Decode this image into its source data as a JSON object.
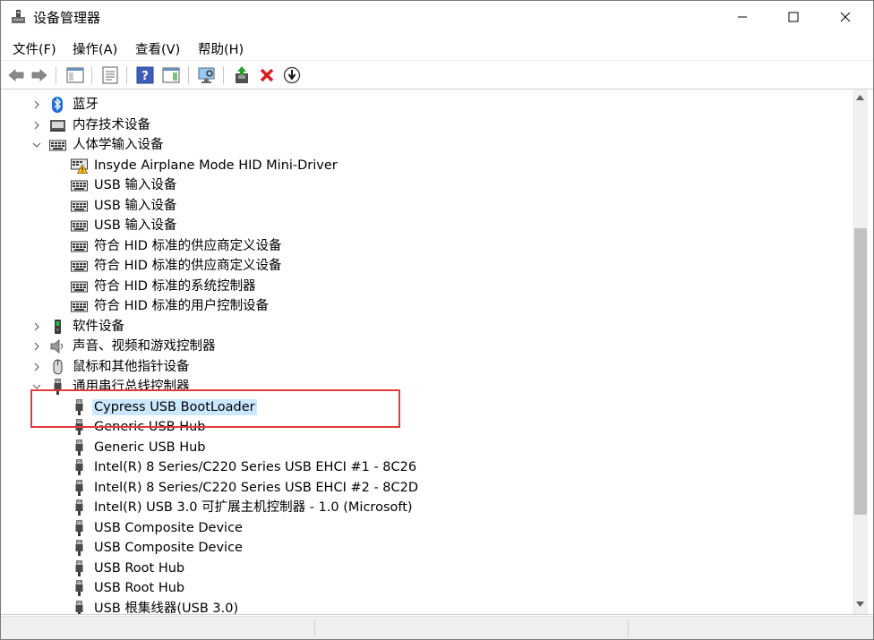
{
  "window": {
    "title": "设备管理器",
    "controls": {
      "minimize": "minimize-icon",
      "maximize": "maximize-icon",
      "close": "close-icon"
    }
  },
  "menu": {
    "items": [
      {
        "label": "文件(F)"
      },
      {
        "label": "操作(A)"
      },
      {
        "label": "查看(V)"
      },
      {
        "label": "帮助(H)"
      }
    ]
  },
  "toolbar": {
    "buttons": [
      "back-icon",
      "forward-icon",
      "show-hide-tree-icon",
      "properties-icon",
      "help-icon",
      "action-pane-icon",
      "scan-hardware-icon",
      "update-driver-icon",
      "uninstall-icon",
      "disable-icon"
    ]
  },
  "tree": {
    "items": [
      {
        "label": "蓝牙",
        "level": 0,
        "expander": "collapsed",
        "icon": "bluetooth-icon"
      },
      {
        "label": "内存技术设备",
        "level": 0,
        "expander": "collapsed",
        "icon": "memory-device-icon"
      },
      {
        "label": "人体学输入设备",
        "level": 0,
        "expander": "expanded",
        "icon": "hid-keyboard-icon"
      },
      {
        "label": "Insyde Airplane Mode HID Mini-Driver",
        "level": 1,
        "icon": "hid-warning-icon"
      },
      {
        "label": "USB 输入设备",
        "level": 1,
        "icon": "hid-keyboard-icon"
      },
      {
        "label": "USB 输入设备",
        "level": 1,
        "icon": "hid-keyboard-icon"
      },
      {
        "label": "USB 输入设备",
        "level": 1,
        "icon": "hid-keyboard-icon"
      },
      {
        "label": "符合 HID 标准的供应商定义设备",
        "level": 1,
        "icon": "hid-keyboard-icon"
      },
      {
        "label": "符合 HID 标准的供应商定义设备",
        "level": 1,
        "icon": "hid-keyboard-icon"
      },
      {
        "label": "符合 HID 标准的系统控制器",
        "level": 1,
        "icon": "hid-keyboard-icon"
      },
      {
        "label": "符合 HID 标准的用户控制设备",
        "level": 1,
        "icon": "hid-keyboard-icon"
      },
      {
        "label": "软件设备",
        "level": 0,
        "expander": "collapsed",
        "icon": "software-device-icon"
      },
      {
        "label": "声音、视频和游戏控制器",
        "level": 0,
        "expander": "collapsed",
        "icon": "speaker-icon"
      },
      {
        "label": "鼠标和其他指针设备",
        "level": 0,
        "expander": "collapsed",
        "icon": "mouse-icon"
      },
      {
        "label": "通用串行总线控制器",
        "level": 0,
        "expander": "expanded",
        "icon": "usb-icon"
      },
      {
        "label": "Cypress USB BootLoader",
        "level": 1,
        "icon": "usb-icon",
        "selected": true
      },
      {
        "label": "Generic USB Hub",
        "level": 1,
        "icon": "usb-icon"
      },
      {
        "label": "Generic USB Hub",
        "level": 1,
        "icon": "usb-icon"
      },
      {
        "label": "Intel(R) 8 Series/C220 Series USB EHCI #1 - 8C26",
        "level": 1,
        "icon": "usb-icon"
      },
      {
        "label": "Intel(R) 8 Series/C220 Series USB EHCI #2 - 8C2D",
        "level": 1,
        "icon": "usb-icon"
      },
      {
        "label": "Intel(R) USB 3.0 可扩展主机控制器 - 1.0 (Microsoft)",
        "level": 1,
        "icon": "usb-icon"
      },
      {
        "label": "USB Composite Device",
        "level": 1,
        "icon": "usb-icon"
      },
      {
        "label": "USB Composite Device",
        "level": 1,
        "icon": "usb-icon"
      },
      {
        "label": "USB Root Hub",
        "level": 1,
        "icon": "usb-icon"
      },
      {
        "label": "USB Root Hub",
        "level": 1,
        "icon": "usb-icon"
      },
      {
        "label": "USB 根集线器(USB 3.0)",
        "level": 1,
        "icon": "usb-icon"
      }
    ]
  },
  "colors": {
    "selection": "#cce8ff",
    "highlight_box": "#e03b3b",
    "scrollbar_thumb": "#c2c2c2"
  }
}
